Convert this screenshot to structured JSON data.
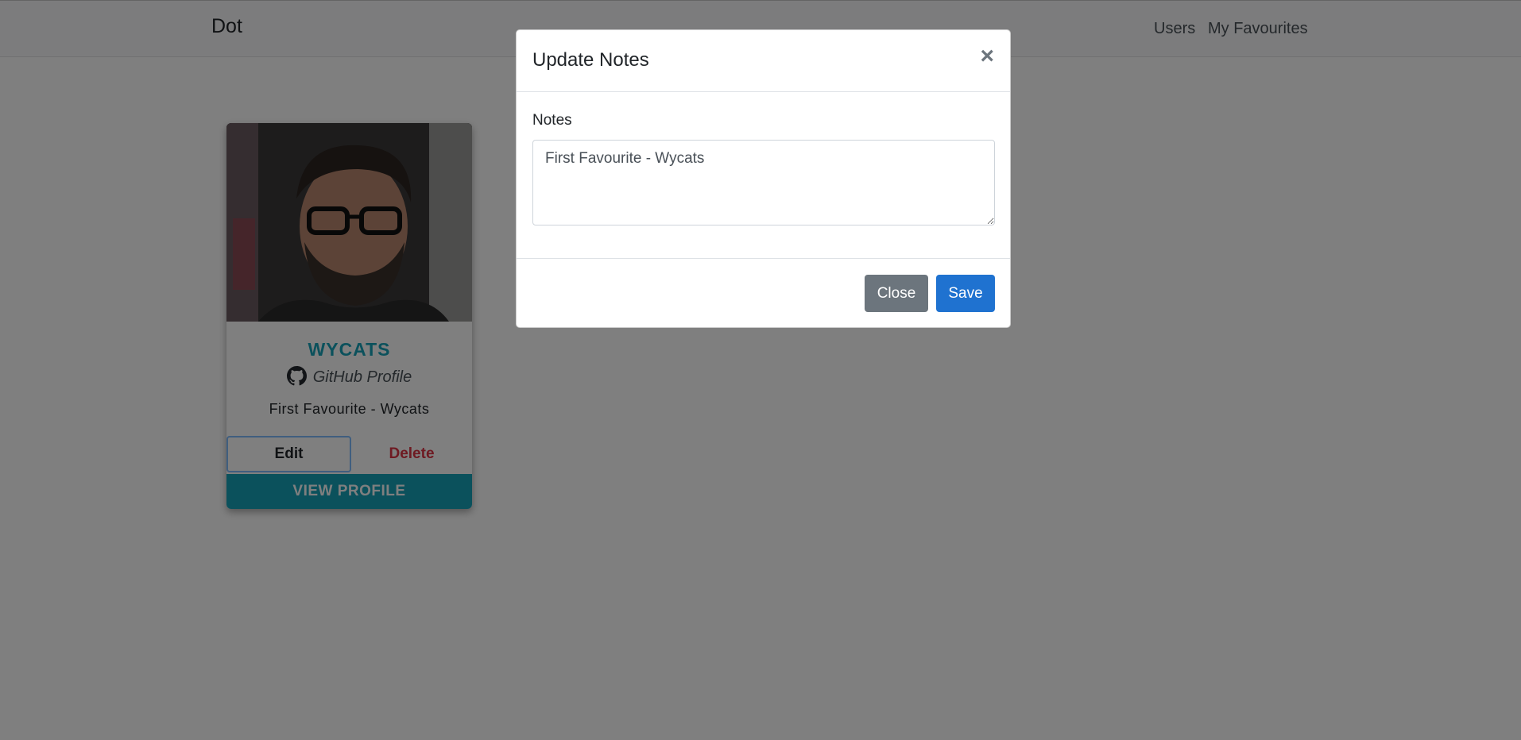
{
  "navbar": {
    "brand": "Dot",
    "links": [
      {
        "label": "Users"
      },
      {
        "label": "My Favourites"
      }
    ]
  },
  "card": {
    "name": "WYCATS",
    "github_label": "GitHub Profile",
    "github_icon": "github-icon",
    "notes": "First Favourite - Wycats",
    "edit_label": "Edit",
    "delete_label": "Delete",
    "view_label": "VIEW PROFILE",
    "accent_color": "#17a2b8",
    "danger_color": "#dc3545"
  },
  "modal": {
    "title": "Update Notes",
    "close_icon": "×",
    "field_label": "Notes",
    "notes_value": "First Favourite - Wycats",
    "close_label": "Close",
    "save_label": "Save",
    "primary_color": "#1f72d0",
    "secondary_color": "#6c757d"
  }
}
